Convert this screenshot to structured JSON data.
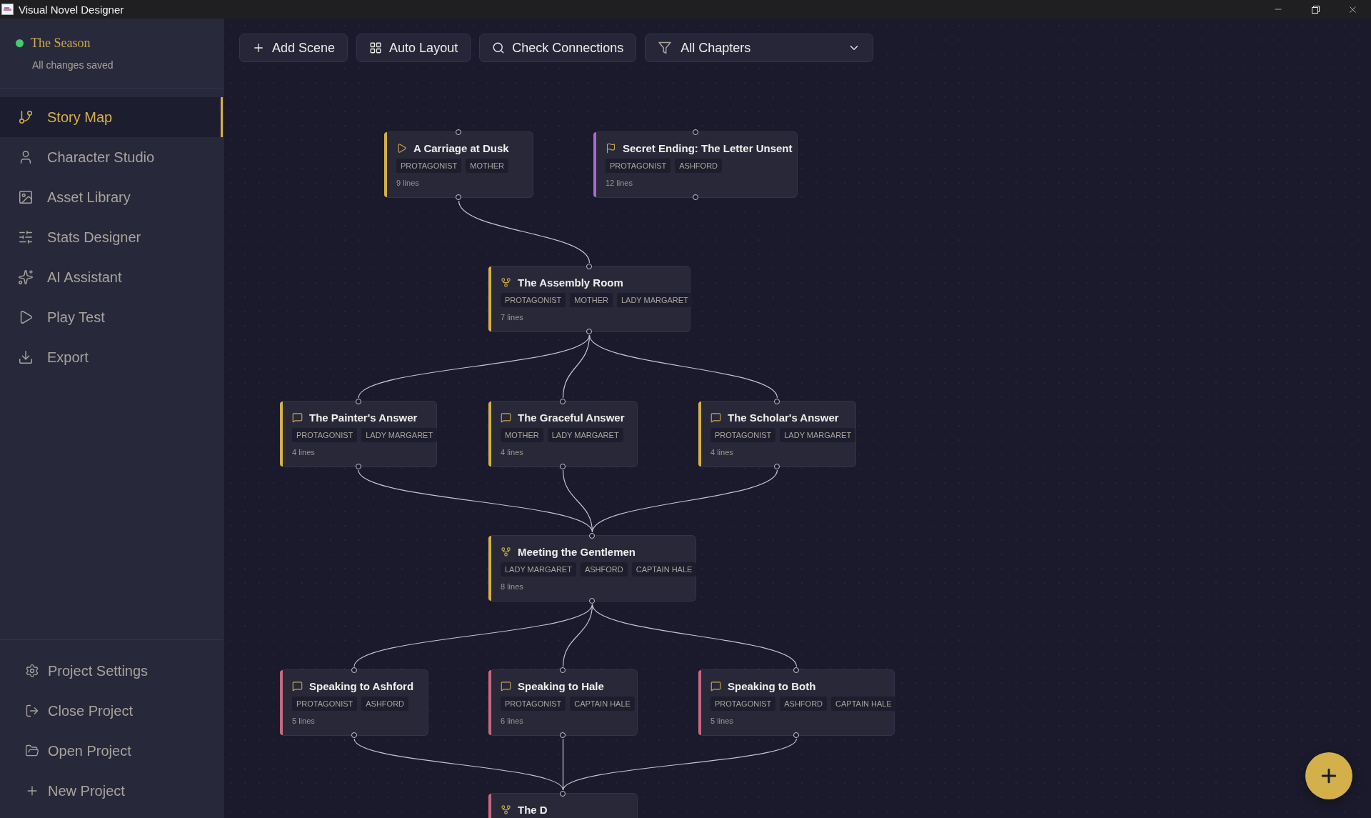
{
  "window": {
    "title": "Visual Novel Designer"
  },
  "project": {
    "name": "The Season",
    "status": "All changes saved",
    "saved": true
  },
  "nav": [
    {
      "label": "Story Map",
      "selected": true
    },
    {
      "label": "Character Studio",
      "selected": false
    },
    {
      "label": "Asset Library",
      "selected": false
    },
    {
      "label": "Stats Designer",
      "selected": false
    },
    {
      "label": "AI Assistant",
      "selected": false
    },
    {
      "label": "Play Test",
      "selected": false
    },
    {
      "label": "Export",
      "selected": false
    }
  ],
  "project_menu": [
    {
      "label": "Project Settings"
    },
    {
      "label": "Close Project"
    },
    {
      "label": "Open Project"
    },
    {
      "label": "New Project"
    }
  ],
  "toolbar": {
    "buttons": [
      {
        "label": "Add Scene"
      },
      {
        "label": "Auto Layout"
      },
      {
        "label": "Check Connections"
      }
    ],
    "chapter_filter": {
      "value": "All Chapters"
    }
  },
  "scenes": [
    {
      "kind": "start",
      "title": "A Carriage at Dusk",
      "color": "#d4b04a",
      "characters": [
        "PROTAGONIST",
        "MOTHER"
      ],
      "lines": "9 lines"
    },
    {
      "kind": "ending",
      "title": "Secret Ending: The Letter Unsent",
      "color": "#b066d0",
      "characters": [
        "PROTAGONIST",
        "ASHFORD"
      ],
      "lines": "12 lines"
    },
    {
      "kind": "branch",
      "title": "The Assembly Room",
      "color": "#d4b04a",
      "characters": [
        "PROTAGONIST",
        "MOTHER",
        "LADY MARGARET"
      ],
      "lines": "7 lines"
    },
    {
      "kind": "dialogue",
      "title": "The Painter's Answer",
      "color": "#d4b04a",
      "characters": [
        "PROTAGONIST",
        "LADY MARGARET"
      ],
      "lines": "4 lines"
    },
    {
      "kind": "dialogue",
      "title": "The Graceful Answer",
      "color": "#d4b04a",
      "characters": [
        "MOTHER",
        "LADY MARGARET"
      ],
      "lines": "4 lines"
    },
    {
      "kind": "dialogue",
      "title": "The Scholar's Answer",
      "color": "#d4b04a",
      "characters": [
        "PROTAGONIST",
        "LADY MARGARET"
      ],
      "lines": "4 lines"
    },
    {
      "kind": "branch",
      "title": "Meeting the Gentlemen",
      "color": "#d4b04a",
      "characters": [
        "LADY MARGARET",
        "ASHFORD",
        "CAPTAIN HALE"
      ],
      "lines": "8 lines"
    },
    {
      "kind": "dialogue",
      "title": "Speaking to Ashford",
      "color": "#c46a80",
      "characters": [
        "PROTAGONIST",
        "ASHFORD"
      ],
      "lines": "5 lines"
    },
    {
      "kind": "dialogue",
      "title": "Speaking to Hale",
      "color": "#c46a80",
      "characters": [
        "PROTAGONIST",
        "CAPTAIN HALE"
      ],
      "lines": "6 lines"
    },
    {
      "kind": "dialogue",
      "title": "Speaking to Both",
      "color": "#c46a80",
      "characters": [
        "PROTAGONIST",
        "ASHFORD",
        "CAPTAIN HALE"
      ],
      "lines": "5 lines"
    },
    {
      "kind": "branch",
      "title": "The D",
      "color": "#c46a80"
    }
  ]
}
